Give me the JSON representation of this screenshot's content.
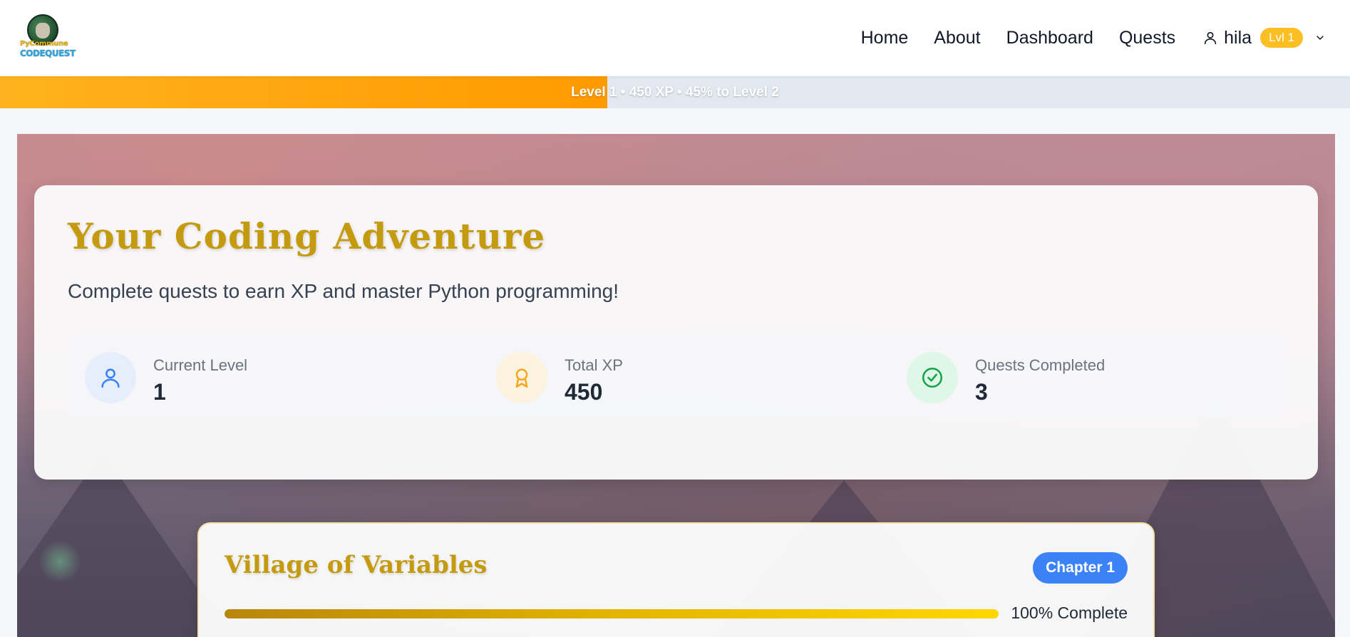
{
  "header": {
    "logo": {
      "line1": "PyCommune",
      "line2": "CODEQUEST"
    },
    "nav": [
      {
        "label": "Home"
      },
      {
        "label": "About"
      },
      {
        "label": "Dashboard"
      },
      {
        "label": "Quests"
      }
    ],
    "user": {
      "name": "hila",
      "level_badge": "Lvl 1",
      "icon": "user-icon",
      "dropdown_icon": "chevron-down-icon"
    }
  },
  "xp_bar": {
    "text": "Level 1 • 450 XP • 45% to Level 2",
    "progress_fraction": 0.45,
    "fill_color": "#ff9a00"
  },
  "adventure": {
    "title": "Your Coding Adventure",
    "subtitle": "Complete quests to earn XP and master Python programming!",
    "stats": [
      {
        "label": "Current Level",
        "value": "1",
        "icon": "user-icon",
        "color": "#3b82f6",
        "bg": "#e6eefb"
      },
      {
        "label": "Total XP",
        "value": "450",
        "icon": "award-icon",
        "color": "#f5a623",
        "bg": "#fcf3de"
      },
      {
        "label": "Quests Completed",
        "value": "3",
        "icon": "check-circle-icon",
        "color": "#16a34a",
        "bg": "#dff7e6"
      }
    ]
  },
  "chapter": {
    "title": "Village of Variables",
    "badge": "Chapter 1",
    "progress_fraction": 1.0,
    "percent_text": "100% Complete",
    "accent": "#c49a0f"
  },
  "colors": {
    "accent_gold": "#c49a0f",
    "badge_yellow": "#fbbf24",
    "chapter_blue": "#3b82f6"
  }
}
